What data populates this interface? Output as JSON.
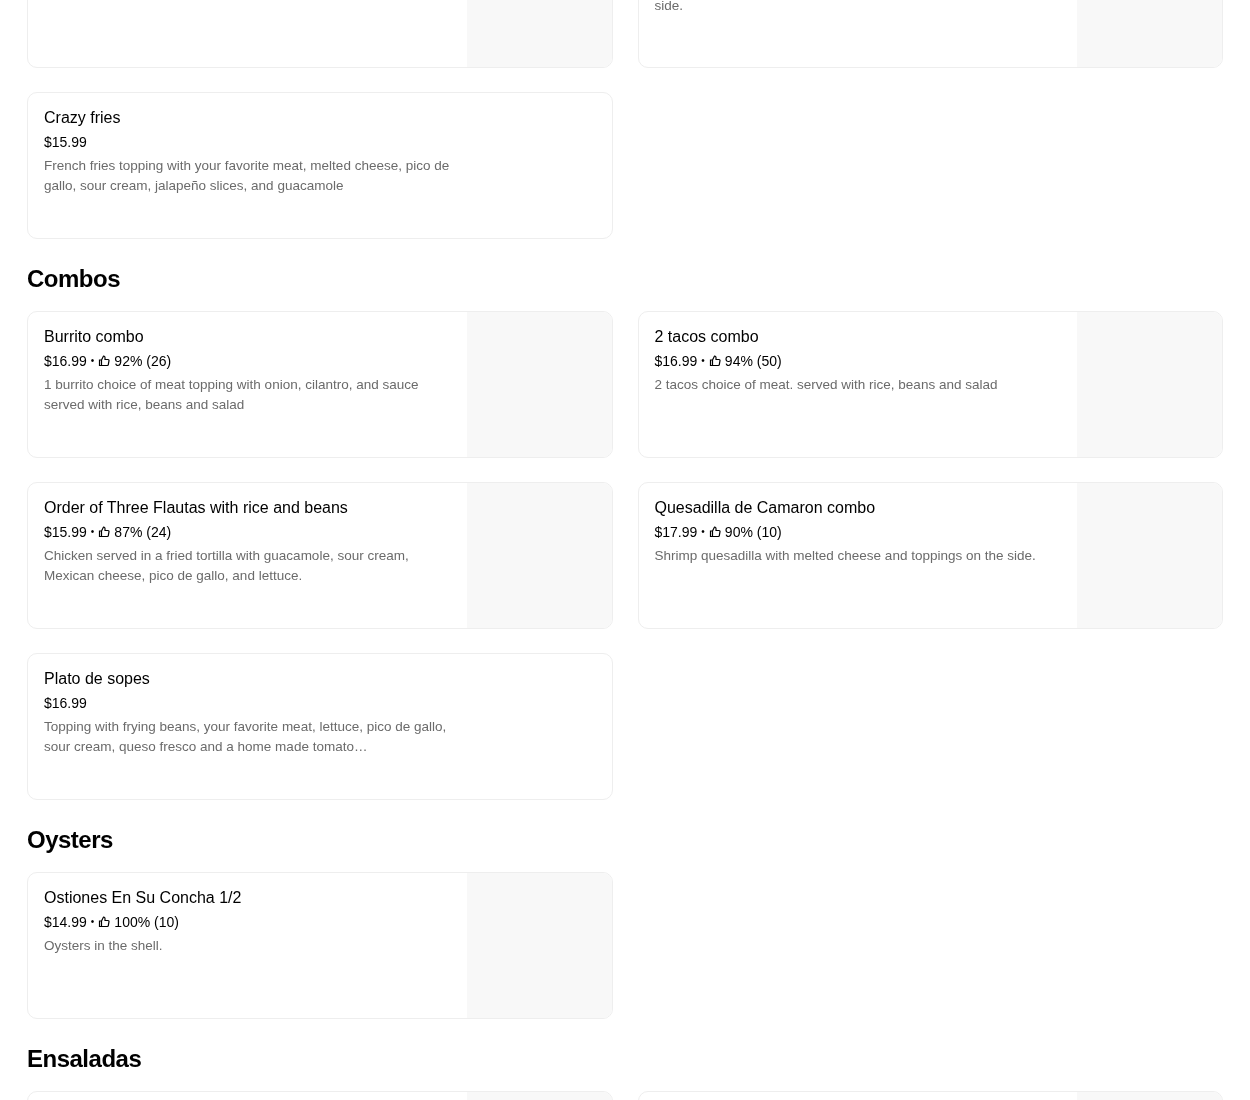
{
  "sections": [
    {
      "items": [
        {
          "kind": "with-image"
        },
        {
          "kind": "with-image",
          "description": "side."
        },
        {
          "kind": "text-only",
          "name": "Crazy fries",
          "price": "$15.99",
          "description": "French fries topping with your favorite meat, melted cheese, pico de gallo, sour cream, jalapeño slices, and guacamole"
        }
      ]
    },
    {
      "heading": "Combos",
      "items": [
        {
          "kind": "with-image",
          "name": "Burrito combo",
          "price": "$16.99",
          "separator": "•",
          "rating": "92% (26)",
          "description": "1 burrito choice of meat topping with onion, cilantro, and sauce served with rice, beans and salad"
        },
        {
          "kind": "with-image",
          "name": "2 tacos combo",
          "price": "$16.99",
          "separator": "•",
          "rating": "94% (50)",
          "description": "2 tacos choice of meat. served with rice, beans and salad"
        },
        {
          "kind": "with-image",
          "name": "Order of Three Flautas with rice and beans",
          "price": "$15.99",
          "separator": "•",
          "rating": "87% (24)",
          "description": "Chicken served in a fried tortilla with guacamole, sour cream, Mexican cheese, pico de gallo, and lettuce."
        },
        {
          "kind": "with-image",
          "name": "Quesadilla de Camaron combo",
          "price": "$17.99",
          "separator": "•",
          "rating": "90% (10)",
          "description": "Shrimp quesadilla with melted cheese and toppings on the side."
        },
        {
          "kind": "text-only",
          "name": "Plato de sopes",
          "price": "$16.99",
          "description": "Topping with frying beans, your favorite meat, lettuce, pico de gallo, sour cream, queso fresco and a home made tomato…"
        }
      ]
    },
    {
      "heading": "Oysters",
      "items": [
        {
          "kind": "with-image",
          "name": "Ostiones En Su Concha 1/2",
          "price": "$14.99",
          "separator": "•",
          "rating": "100% (10)",
          "description": "Oysters in the shell."
        }
      ]
    },
    {
      "heading": "Ensaladas",
      "items": [
        {
          "kind": "with-image"
        },
        {
          "kind": "with-image"
        }
      ]
    }
  ]
}
